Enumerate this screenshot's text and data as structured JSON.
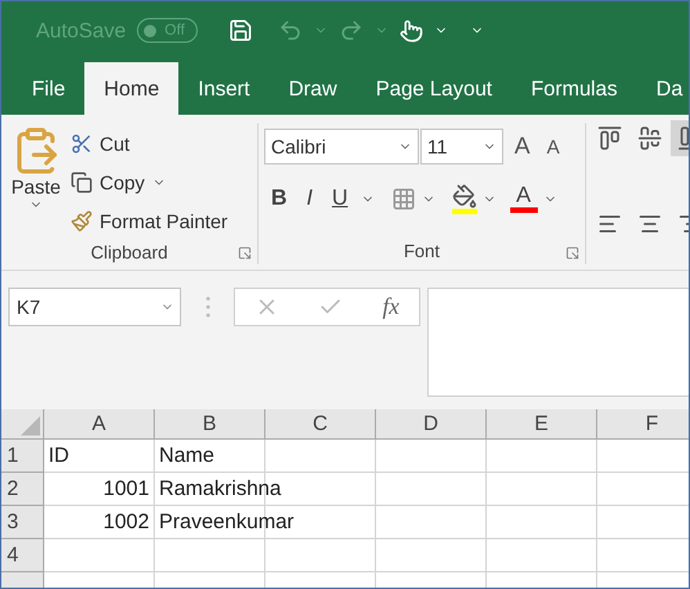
{
  "title_bar": {
    "autosave": {
      "label": "AutoSave",
      "on": false,
      "state_text": "Off"
    }
  },
  "tabs": [
    {
      "label": "File",
      "selected": false
    },
    {
      "label": "Home",
      "selected": true
    },
    {
      "label": "Insert",
      "selected": false
    },
    {
      "label": "Draw",
      "selected": false
    },
    {
      "label": "Page Layout",
      "selected": false
    },
    {
      "label": "Formulas",
      "selected": false
    },
    {
      "label": "Da",
      "selected": false
    }
  ],
  "ribbon": {
    "clipboard": {
      "label": "Clipboard",
      "paste": "Paste",
      "cut": "Cut",
      "copy": "Copy",
      "format_painter": "Format Painter"
    },
    "font": {
      "label": "Font",
      "font_name": "Calibri",
      "font_size": "11",
      "grow": "A",
      "shrink": "A",
      "bold": "B",
      "italic": "I",
      "underline": "U",
      "font_color": "A"
    },
    "alignment": [
      {
        "kind": "top",
        "selected": false
      },
      {
        "kind": "middle",
        "selected": false
      },
      {
        "kind": "bottom",
        "selected": true
      },
      {
        "kind": "left",
        "selected": false
      },
      {
        "kind": "center",
        "selected": false
      },
      {
        "kind": "right",
        "selected": false
      }
    ]
  },
  "name_box": {
    "value": "K7"
  },
  "formula_bar": {
    "fx": "fx"
  },
  "sheet": {
    "columns": [
      "A",
      "B",
      "C",
      "D",
      "E",
      "F"
    ],
    "rows": [
      {
        "label": "1",
        "cells": [
          {
            "kind": "text",
            "text": "ID"
          },
          {
            "kind": "text",
            "text": "Name"
          }
        ]
      },
      {
        "label": "2",
        "cells": [
          {
            "kind": "number",
            "text": "1001"
          },
          {
            "kind": "text",
            "text": "Ramakrishna"
          }
        ]
      },
      {
        "label": "3",
        "cells": [
          {
            "kind": "number",
            "text": "1002"
          },
          {
            "kind": "text",
            "text": "Praveenkumar"
          }
        ]
      },
      {
        "label": "4",
        "cells": []
      }
    ]
  }
}
